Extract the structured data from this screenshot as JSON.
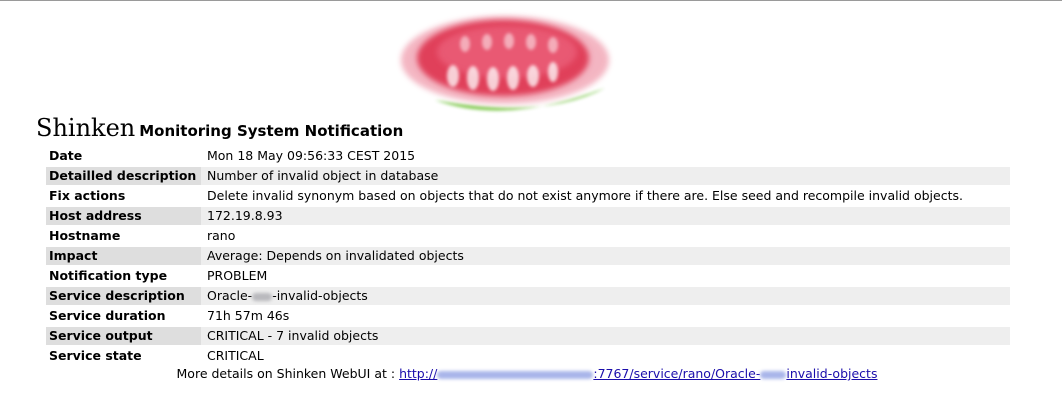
{
  "header": {
    "brand": "Shinken",
    "subtitle": "Monitoring System Notification"
  },
  "colors": {
    "logo_red": "#e0405a",
    "logo_green": "#7cc84a",
    "link": "#1a0dab",
    "row_shade": "#eeeeee",
    "key_shade": "#dedede"
  },
  "details": {
    "date": {
      "label": "Date",
      "value": "Mon 18 May 09:56:33 CEST 2015"
    },
    "description": {
      "label": "Detailled description",
      "value": "Number of invalid object in database"
    },
    "fix": {
      "label": "Fix actions",
      "value": "Delete invalid synonym based on objects that do not exist anymore if there are. Else seed and recompile invalid objects."
    },
    "host_address": {
      "label": "Host address",
      "value": "172.19.8.93"
    },
    "hostname": {
      "label": "Hostname",
      "value": "rano"
    },
    "impact": {
      "label": "Impact",
      "value": "Average: Depends on invalidated objects"
    },
    "notification_type": {
      "label": "Notification type",
      "value": "PROBLEM"
    },
    "service_description": {
      "label": "Service description",
      "value_prefix": "Oracle-",
      "value_suffix": "-invalid-objects"
    },
    "service_duration": {
      "label": "Service duration",
      "value": "71h 57m 46s"
    },
    "service_output": {
      "label": "Service output",
      "value": "CRITICAL - 7 invalid objects"
    },
    "service_state": {
      "label": "Service state",
      "value": "CRITICAL"
    }
  },
  "footer": {
    "text": "More details on Shinken WebUI at :",
    "link_prefix": "http://",
    "link_middle": ":7767/service/rano/Oracle-",
    "link_suffix": "invalid-objects"
  }
}
